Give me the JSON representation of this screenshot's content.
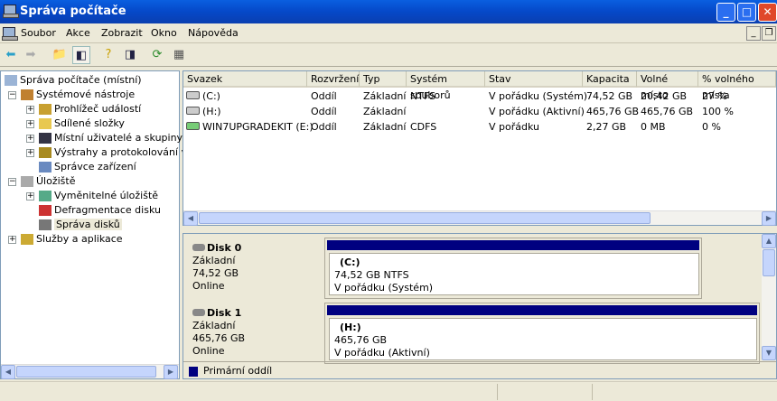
{
  "window": {
    "title": "Správa počítače"
  },
  "menu": [
    "Soubor",
    "Akce",
    "Zobrazit",
    "Okno",
    "Nápověda"
  ],
  "tree": [
    {
      "label": "Správa počítače (místní)",
      "level": 0
    },
    {
      "label": "Systémové nástroje",
      "level": 1,
      "exp": "−"
    },
    {
      "label": "Prohlížeč událostí",
      "level": 2,
      "exp": "+"
    },
    {
      "label": "Sdílené složky",
      "level": 2,
      "exp": "+"
    },
    {
      "label": "Místní uživatelé a skupiny",
      "level": 2,
      "exp": "+"
    },
    {
      "label": "Výstrahy a protokolování vý",
      "level": 2,
      "exp": "+"
    },
    {
      "label": "Správce zařízení",
      "level": 2
    },
    {
      "label": "Úložiště",
      "level": 1,
      "exp": "−"
    },
    {
      "label": "Vyměnitelné úložiště",
      "level": 2,
      "exp": "+"
    },
    {
      "label": "Defragmentace disku",
      "level": 2
    },
    {
      "label": "Správa disků",
      "level": 2,
      "selected": true
    },
    {
      "label": "Služby a aplikace",
      "level": 1,
      "exp": "+"
    }
  ],
  "volumes": {
    "columns": [
      "Svazek",
      "Rozvržení",
      "Typ",
      "Systém souborů",
      "Stav",
      "Kapacita",
      "Volné místo",
      "% volného místa"
    ],
    "rows": [
      [
        "(C:)",
        "Oddíl",
        "Základní",
        "NTFS",
        "V pořádku (Systém)",
        "74,52 GB",
        "20,42 GB",
        "27 %"
      ],
      [
        "(H:)",
        "Oddíl",
        "Základní",
        "",
        "V pořádku (Aktivní)",
        "465,76 GB",
        "465,76 GB",
        "100 %"
      ],
      [
        "WIN7UPGRADEKIT (E:)",
        "Oddíl",
        "Základní",
        "CDFS",
        "V pořádku",
        "2,27 GB",
        "0 MB",
        "0 %"
      ]
    ]
  },
  "disks": [
    {
      "name": "Disk 0",
      "type": "Základní",
      "size": "74,52 GB",
      "state": "Online",
      "part_name": "(C:)",
      "part_size": "74,52 GB NTFS",
      "part_state": "V pořádku (Systém)"
    },
    {
      "name": "Disk 1",
      "type": "Základní",
      "size": "465,76 GB",
      "state": "Online",
      "part_name": "(H:)",
      "part_size": "465,76 GB",
      "part_state": "V pořádku (Aktivní)"
    }
  ],
  "legend": {
    "label": "Primární oddíl",
    "color": "#000080"
  }
}
